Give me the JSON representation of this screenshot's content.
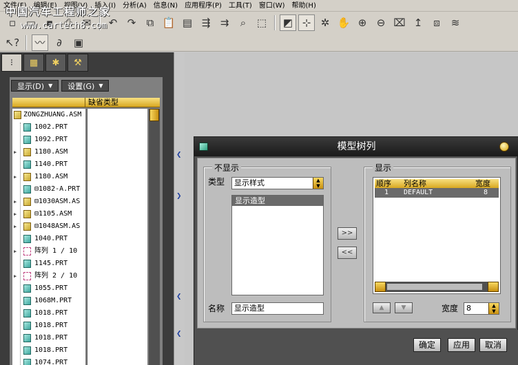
{
  "menubar": {
    "items": [
      "文件(F)",
      "编辑(E)",
      "视图(V)",
      "插入(I)",
      "分析(A)",
      "信息(N)",
      "应用程序(P)",
      "工具(T)",
      "窗口(W)",
      "帮助(H)"
    ]
  },
  "watermark": {
    "title": "中国汽车工程师之家",
    "url": "www.cartech8.com"
  },
  "navigator": {
    "show_button": "显示(D)",
    "settings_button": "设置(G)",
    "column_header": "缺省类型",
    "root": "ZONGZHUANG.ASM",
    "items": [
      {
        "label": "1002.PRT",
        "type": "part",
        "expandable": false
      },
      {
        "label": "1092.PRT",
        "type": "part",
        "expandable": false
      },
      {
        "label": "1180.ASM",
        "type": "asm",
        "expandable": true
      },
      {
        "label": "1140.PRT",
        "type": "part",
        "expandable": false
      },
      {
        "label": "1180.ASM",
        "type": "asm",
        "expandable": true
      },
      {
        "label": "⊟1082-A.PRT",
        "type": "part",
        "expandable": false
      },
      {
        "label": "⊟1030ASM.AS",
        "type": "asm",
        "expandable": true
      },
      {
        "label": "⊟1105.ASM",
        "type": "asm",
        "expandable": true
      },
      {
        "label": "⊟1048ASM.AS",
        "type": "asm",
        "expandable": true
      },
      {
        "label": "1040.PRT",
        "type": "part",
        "expandable": false
      },
      {
        "label": "阵列 1 / 10",
        "type": "pattern",
        "expandable": true
      },
      {
        "label": "1145.PRT",
        "type": "part",
        "expandable": false
      },
      {
        "label": "阵列 2 / 10",
        "type": "pattern",
        "expandable": true
      },
      {
        "label": "1055.PRT",
        "type": "part",
        "expandable": false
      },
      {
        "label": "1068M.PRT",
        "type": "part",
        "expandable": false
      },
      {
        "label": "1018.PRT",
        "type": "part",
        "expandable": false
      },
      {
        "label": "1018.PRT",
        "type": "part",
        "expandable": false
      },
      {
        "label": "1018.PRT",
        "type": "part",
        "expandable": false
      },
      {
        "label": "1018.PRT",
        "type": "part",
        "expandable": false
      },
      {
        "label": "1074.PRT",
        "type": "part",
        "expandable": false
      }
    ]
  },
  "dialog": {
    "title": "模型树列",
    "not_shown": {
      "group_label": "不显示",
      "type_label": "类型",
      "type_value": "显示样式",
      "list_items": [
        "显示造型"
      ],
      "name_label": "名称",
      "name_value": "显示造型"
    },
    "add_button": ">>",
    "remove_button": "<<",
    "shown": {
      "group_label": "显示",
      "columns": [
        "顺序",
        "列名称",
        "宽度"
      ],
      "rows": [
        {
          "order": "1",
          "name": "DEFAULT",
          "width": "8"
        }
      ],
      "width_label": "宽度",
      "width_value": "8"
    },
    "buttons": {
      "ok": "确定",
      "apply": "应用",
      "cancel": "取消"
    }
  }
}
